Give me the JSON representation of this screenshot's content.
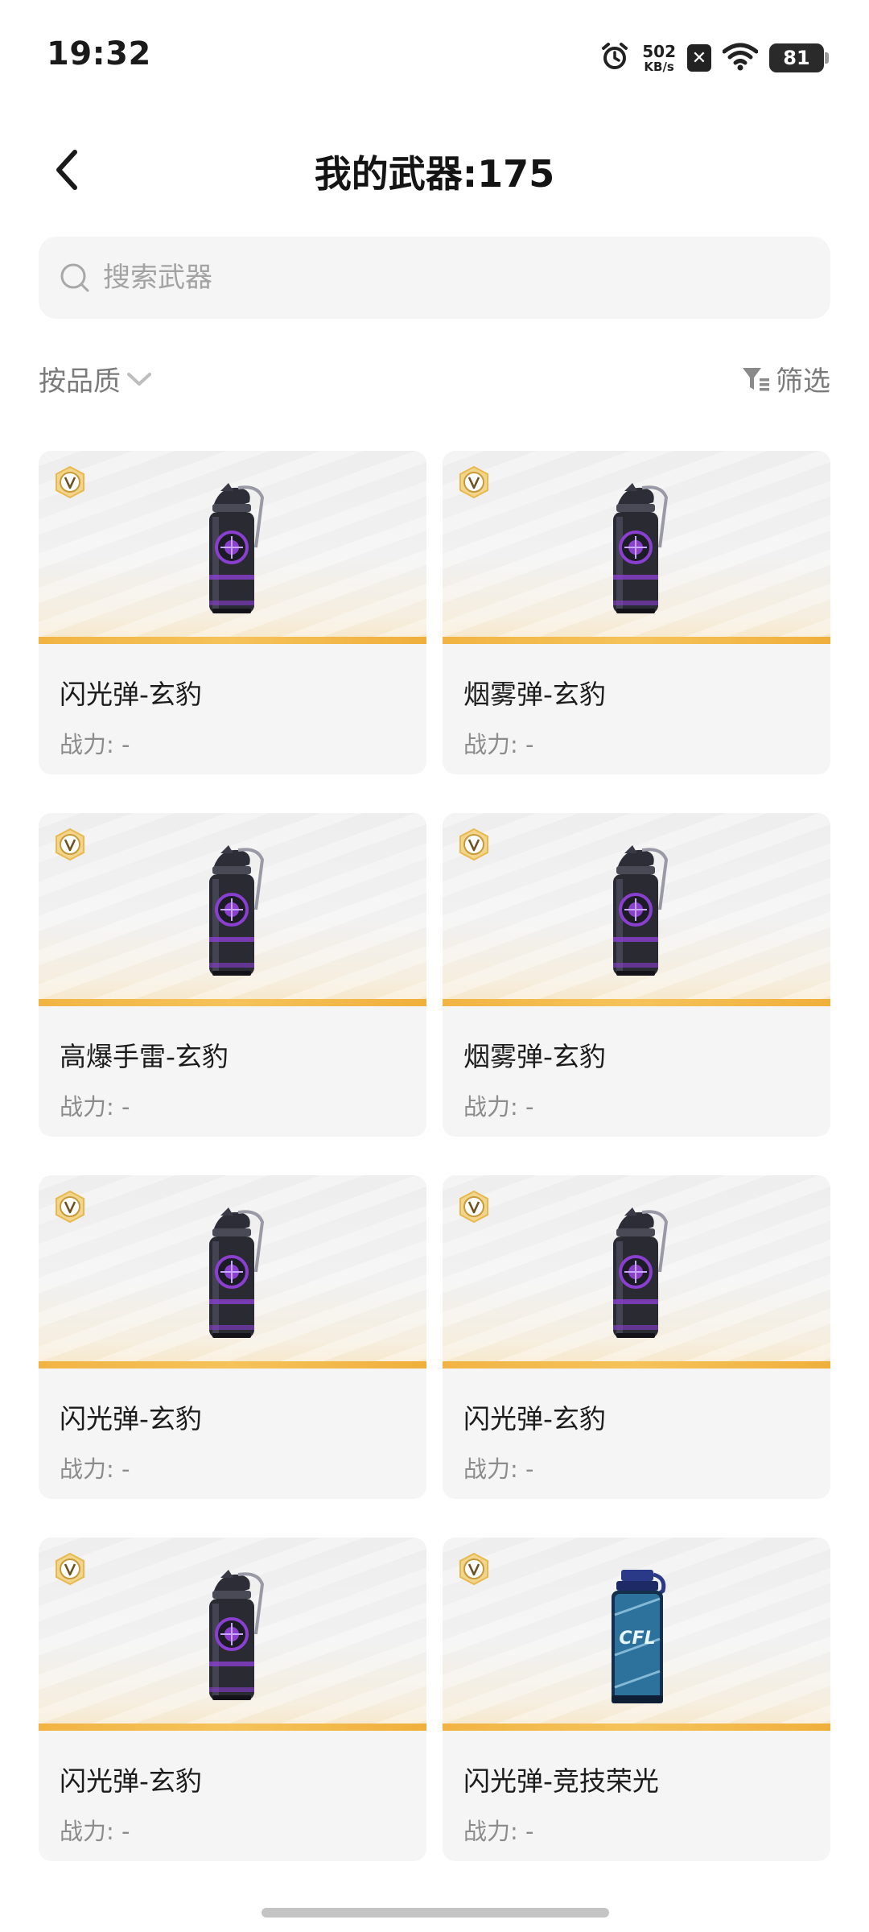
{
  "status_bar": {
    "time": "19:32",
    "net_speed_value": "502",
    "net_speed_unit": "KB/s",
    "battery": "81",
    "icons": [
      "alarm-icon",
      "x-app-icon",
      "wifi-icon",
      "battery-icon"
    ]
  },
  "header": {
    "title": "我的武器:175",
    "back_icon": "chevron-left-icon"
  },
  "search": {
    "placeholder": "搜索武器",
    "value": ""
  },
  "toolbar": {
    "sort_label": "按品质",
    "filter_label": "筛选"
  },
  "weapons": [
    {
      "name": "闪光弹-玄豹",
      "power": "战力: -",
      "style": "dark"
    },
    {
      "name": "烟雾弹-玄豹",
      "power": "战力: -",
      "style": "dark"
    },
    {
      "name": "高爆手雷-玄豹",
      "power": "战力: -",
      "style": "dark"
    },
    {
      "name": "烟雾弹-玄豹",
      "power": "战力: -",
      "style": "dark"
    },
    {
      "name": "闪光弹-玄豹",
      "power": "战力: -",
      "style": "dark"
    },
    {
      "name": "闪光弹-玄豹",
      "power": "战力: -",
      "style": "dark"
    },
    {
      "name": "闪光弹-玄豹",
      "power": "战力: -",
      "style": "dark"
    },
    {
      "name": "闪光弹-竞技荣光",
      "power": "战力: -",
      "style": "blue"
    }
  ],
  "colors": {
    "accent_gold": "#f1b443",
    "card_bg": "#f5f5f5",
    "grenade_purple": "#8a3fd1",
    "grenade_blue": "#3fa9e0"
  }
}
